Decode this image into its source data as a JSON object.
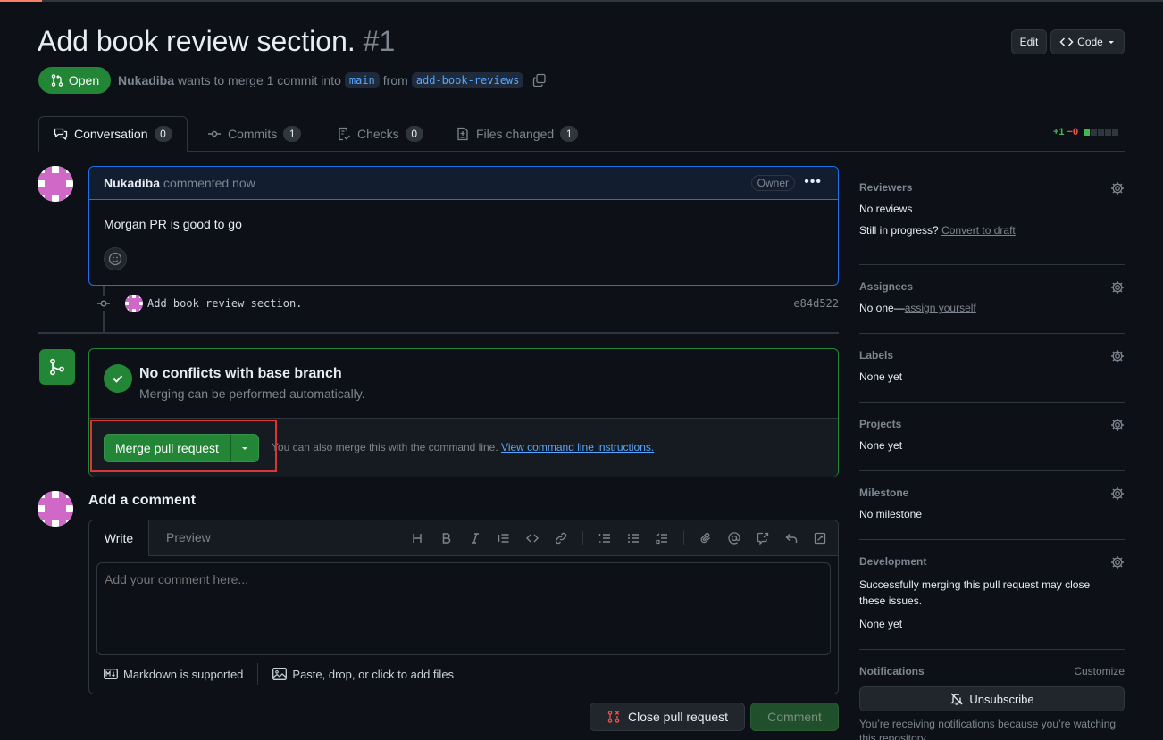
{
  "header": {
    "title": "Add book review section.",
    "number": "#1",
    "edit_label": "Edit",
    "code_label": "Code"
  },
  "status": {
    "state_label": "Open",
    "author": "Nukadiba",
    "merge_text": "wants to merge 1 commit into",
    "base_branch": "main",
    "from_text": "from",
    "head_branch": "add-book-reviews"
  },
  "tabs": [
    {
      "label": "Conversation",
      "count": "0",
      "icon": "comment-discussion-icon"
    },
    {
      "label": "Commits",
      "count": "1",
      "icon": "git-commit-icon"
    },
    {
      "label": "Checks",
      "count": "0",
      "icon": "checklist-icon"
    },
    {
      "label": "Files changed",
      "count": "1",
      "icon": "file-diff-icon"
    }
  ],
  "diffstat": {
    "additions": "+1",
    "deletions": "−0"
  },
  "comment": {
    "author": "Nukadiba",
    "meta": "commented now",
    "role_badge": "Owner",
    "body": "Morgan PR is good to go"
  },
  "commit": {
    "message": "Add book review section.",
    "sha": "e84d522"
  },
  "merge": {
    "heading": "No conflicts with base branch",
    "subtext": "Merging can be performed automatically.",
    "button_label": "Merge pull request",
    "cli_text": "You can also merge this with the command line.",
    "cli_link": "View command line instructions."
  },
  "new_comment": {
    "title": "Add a comment",
    "write_tab": "Write",
    "preview_tab": "Preview",
    "placeholder": "Add your comment here...",
    "markdown_note": "Markdown is supported",
    "attach_note": "Paste, drop, or click to add files",
    "close_label": "Close pull request",
    "comment_label": "Comment"
  },
  "sidebar": {
    "reviewers": {
      "title": "Reviewers",
      "value": "No reviews",
      "draft_prefix": "Still in progress?",
      "draft_link": "Convert to draft"
    },
    "assignees": {
      "title": "Assignees",
      "value": "No one—",
      "assign_link": "assign yourself"
    },
    "labels": {
      "title": "Labels",
      "value": "None yet"
    },
    "projects": {
      "title": "Projects",
      "value": "None yet"
    },
    "milestone": {
      "title": "Milestone",
      "value": "No milestone"
    },
    "development": {
      "title": "Development",
      "text": "Successfully merging this pull request may close these issues.",
      "value": "None yet"
    },
    "notifications": {
      "title": "Notifications",
      "customize": "Customize",
      "button": "Unsubscribe",
      "text": "You’re receiving notifications because you’re watching this repository."
    }
  },
  "colors": {
    "background": "#0d1117",
    "accent_green": "#238636",
    "link_blue": "#58a6ff",
    "highlight_red": "#da3633"
  }
}
